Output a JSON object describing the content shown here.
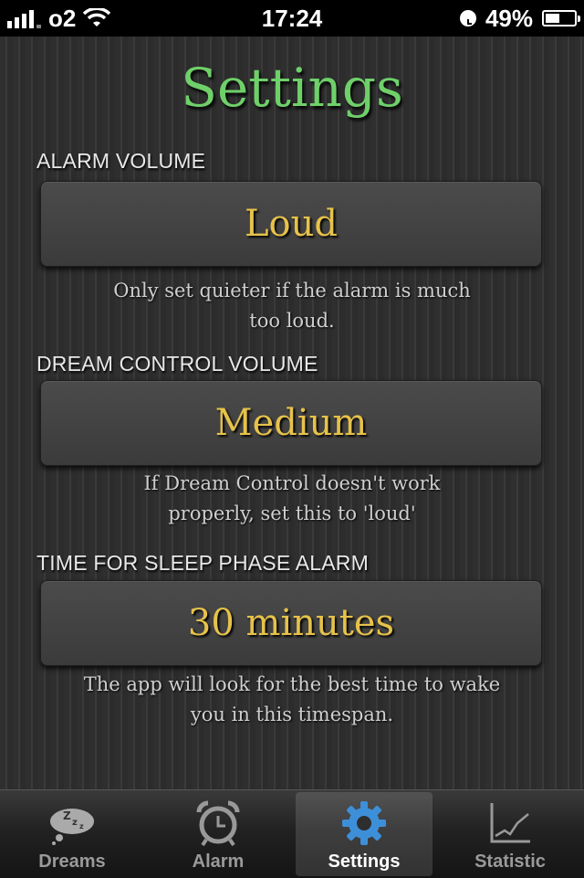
{
  "status_bar": {
    "carrier": "o2",
    "time": "17:24",
    "battery": "49%",
    "battery_level": 0.49,
    "signal_icon": "signal-bars-icon",
    "wifi_icon": "wifi-icon",
    "clock_icon": "alarm-clock-status-icon"
  },
  "page": {
    "title": "Settings",
    "title_color": "#6fd06a",
    "value_color": "#e6c24a"
  },
  "sections": [
    {
      "label": "ALARM VOLUME",
      "value": "Loud",
      "hint_line1": "Only set quieter if the alarm is much",
      "hint_line2": "too loud."
    },
    {
      "label": "DREAM CONTROL VOLUME",
      "value": "Medium",
      "hint_line1": "If Dream Control doesn't work",
      "hint_line2": "properly, set this to 'loud'"
    },
    {
      "label": "TIME FOR SLEEP PHASE ALARM",
      "value": "30 minutes",
      "hint_line1": "The app will look for the best time to wake",
      "hint_line2": "you in this timespan."
    }
  ],
  "tabs": [
    {
      "label": "Dreams",
      "icon": "sleep-cloud-icon",
      "active": false
    },
    {
      "label": "Alarm",
      "icon": "alarm-clock-icon",
      "active": false
    },
    {
      "label": "Settings",
      "icon": "gear-icon",
      "active": true
    },
    {
      "label": "Statistic",
      "icon": "line-chart-icon",
      "active": false
    }
  ]
}
